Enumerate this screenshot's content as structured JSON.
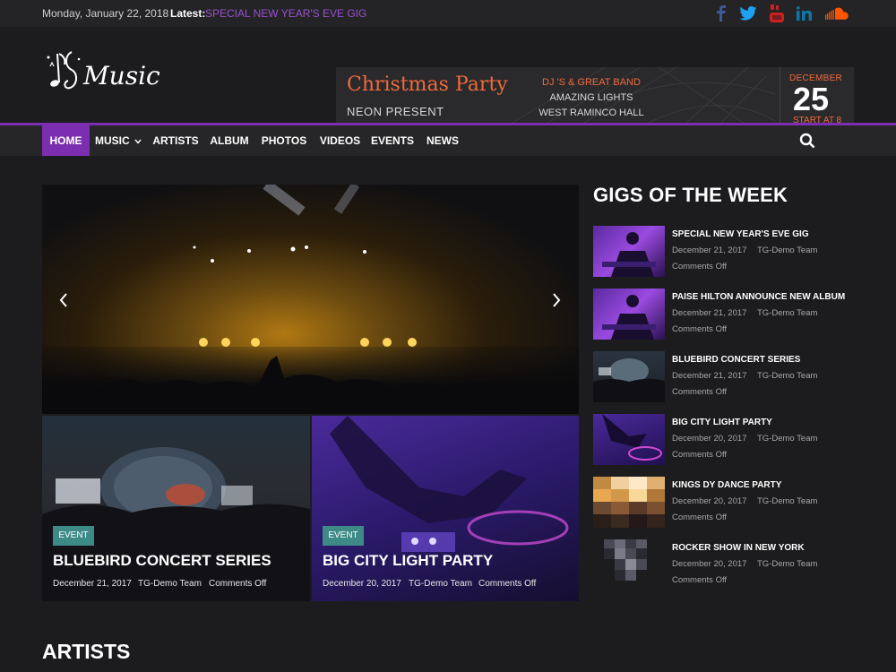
{
  "topbar": {
    "date": "Monday, January 22, 2018",
    "latest_label": "Latest:",
    "latest_link": "SPECIAL NEW YEAR'S EVE GIG",
    "social": [
      "facebook-icon",
      "twitter-icon",
      "youtube-icon",
      "linkedin-icon",
      "soundcloud-icon"
    ],
    "social_colors": {
      "facebook": "#3b5998",
      "twitter": "#1da1f2",
      "youtube": "#cd201f",
      "linkedin": "#0e76a8",
      "soundcloud": "#ff5500"
    }
  },
  "header": {
    "logo_text": "Music",
    "banner": {
      "title": "Christmas Party",
      "subtitle": "NEON PRESENT",
      "line1": "DJ 'S & GREAT BAND",
      "line2": "AMAZING LIGHTS",
      "line3": "WEST RAMINCO HALL",
      "month": "DECEMBER",
      "day": "25",
      "start": "START AT 8"
    }
  },
  "nav": {
    "items": [
      {
        "label": "HOME",
        "active": true
      },
      {
        "label": "MUSIC",
        "dropdown": true
      },
      {
        "label": "ARTISTS"
      },
      {
        "label": "ALBUM"
      },
      {
        "label": "PHOTOS"
      },
      {
        "label": "VIDEOS"
      },
      {
        "label": "EVENTS"
      },
      {
        "label": "NEWS"
      }
    ],
    "search_icon": "search-icon"
  },
  "slider": {
    "prev_icon": "chevron-left-icon",
    "next_icon": "chevron-right-icon"
  },
  "featured": [
    {
      "badge": "EVENT",
      "title": "BLUEBIRD CONCERT SERIES",
      "date": "December 21, 2017",
      "author": "TG-Demo Team",
      "comments": "Comments Off"
    },
    {
      "badge": "EVENT",
      "title": "BIG CITY LIGHT PARTY",
      "date": "December 20, 2017",
      "author": "TG-Demo Team",
      "comments": "Comments Off"
    }
  ],
  "sidebar": {
    "title": "GIGS OF THE WEEK",
    "items": [
      {
        "title": "SPECIAL NEW YEAR'S EVE GIG",
        "date": "December 21, 2017",
        "author": "TG-Demo Team",
        "comments": "Comments Off"
      },
      {
        "title": "PAISE HILTON ANNOUNCE NEW ALBUM",
        "date": "December 21, 2017",
        "author": "TG-Demo Team",
        "comments": "Comments Off"
      },
      {
        "title": "BLUEBIRD CONCERT SERIES",
        "date": "December 21, 2017",
        "author": "TG-Demo Team",
        "comments": "Comments Off"
      },
      {
        "title": "BIG CITY LIGHT PARTY",
        "date": "December 20, 2017",
        "author": "TG-Demo Team",
        "comments": "Comments Off"
      },
      {
        "title": "KINGS DY DANCE PARTY",
        "date": "December 20, 2017",
        "author": "TG-Demo Team",
        "comments": "Comments Off"
      },
      {
        "title": "ROCKER SHOW IN NEW YORK",
        "date": "December 20, 2017",
        "author": "TG-Demo Team",
        "comments": "Comments Off"
      }
    ]
  },
  "artists": {
    "title": "ARTISTS"
  },
  "colors": {
    "accent": "#7b2fb0",
    "badge": "#3d8a86",
    "banner_orange": "#f06a3c",
    "latest_link": "#9a4fd0"
  }
}
